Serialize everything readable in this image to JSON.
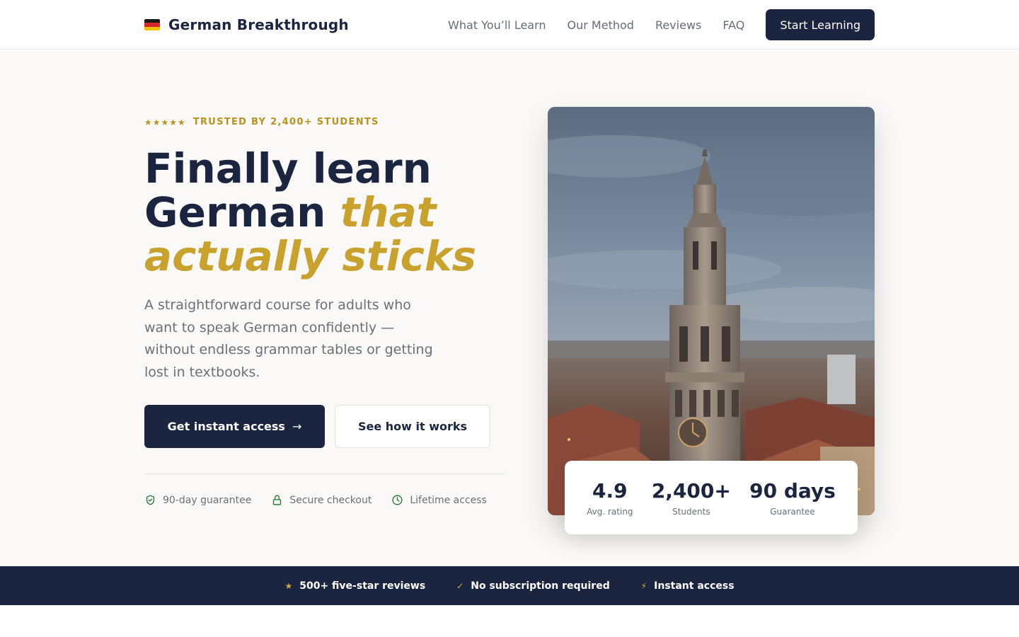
{
  "nav": {
    "brand": "German Breakthrough",
    "links": [
      "What You’ll Learn",
      "Our Method",
      "Reviews",
      "FAQ"
    ],
    "cta": "Start Learning"
  },
  "hero": {
    "eyebrow_stars": "★★★★★",
    "eyebrow_text": "TRUSTED BY 2,400+ STUDENTS",
    "headline_line1": "Finally learn",
    "headline_line2_plain": "German ",
    "headline_line2_accent": "that",
    "headline_line3_accent": "actually sticks",
    "subtext": "A straightforward course for adults who want to speak German confidently — without endless grammar tables or getting lost in textbooks.",
    "primary_button": "Get instant access",
    "primary_button_arrow": "→",
    "secondary_button": "See how it works",
    "assurances": [
      {
        "icon": "shield-check-icon",
        "label": "90-day guarantee"
      },
      {
        "icon": "lock-icon",
        "label": "Secure checkout"
      },
      {
        "icon": "clock-icon",
        "label": "Lifetime access"
      }
    ]
  },
  "stats": [
    {
      "value": "4.9",
      "label": "Avg. rating"
    },
    {
      "value": "2,400+",
      "label": "Students"
    },
    {
      "value": "90 days",
      "label": "Guarantee"
    }
  ],
  "banner": [
    {
      "icon": "★",
      "label": "500+ five-star reviews"
    },
    {
      "icon": "✓",
      "label": "No subscription required"
    },
    {
      "icon": "⚡",
      "label": "Instant access"
    }
  ],
  "colors": {
    "navy": "#1b2540",
    "gold": "#c9a22e",
    "hero_bg": "#faf9f7",
    "muted_text": "#6b6f78",
    "icon_green": "#2e7d3a"
  }
}
